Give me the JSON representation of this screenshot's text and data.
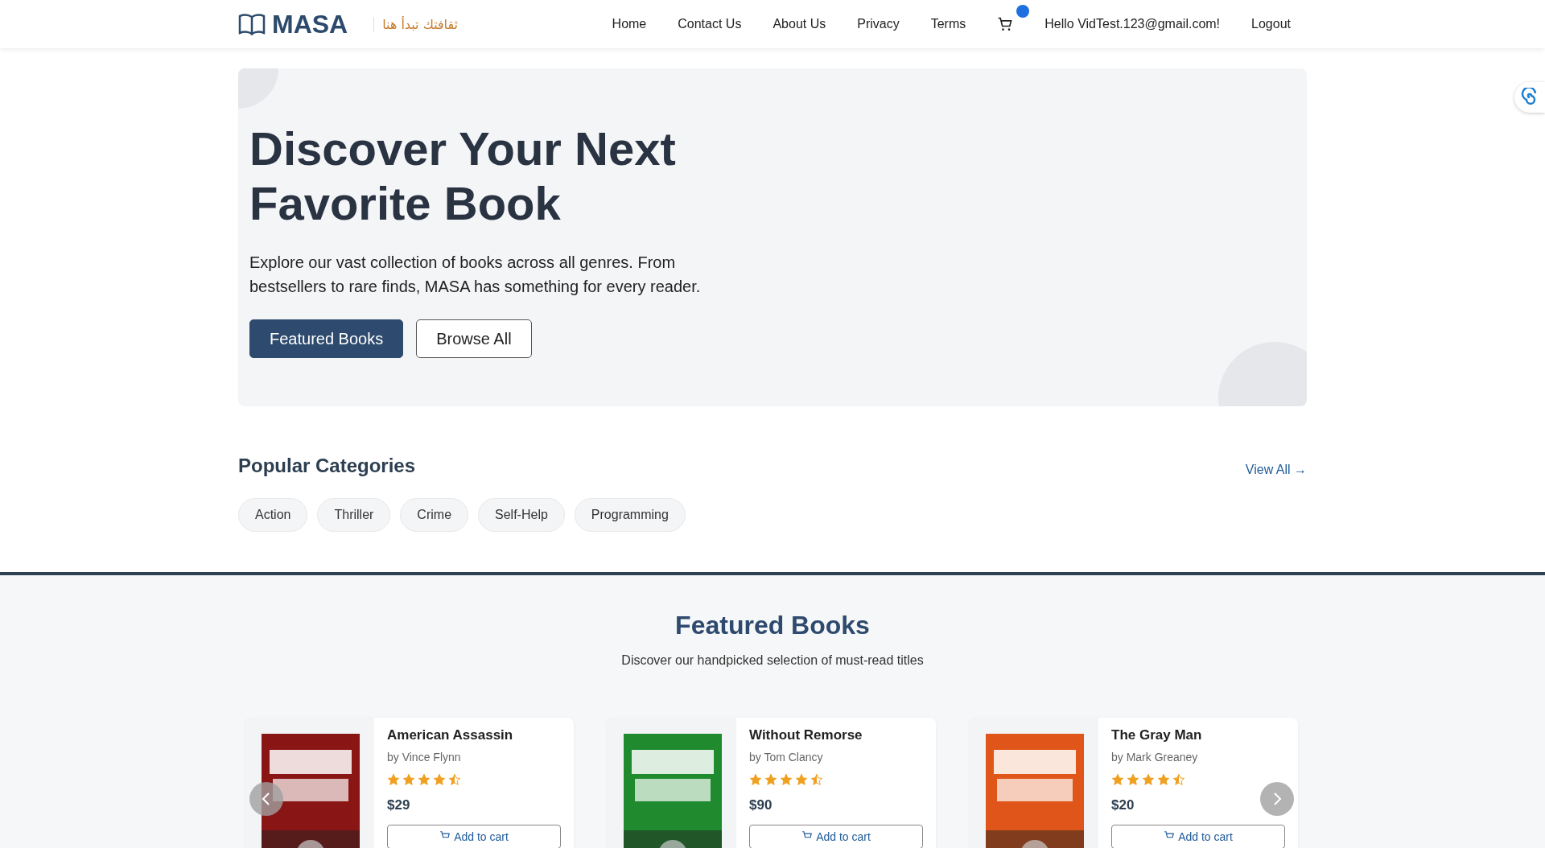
{
  "header": {
    "brand": "MASA",
    "tagline": "ثقافتك تبدأ هنا",
    "nav": [
      {
        "label": "Home",
        "kind": "link"
      },
      {
        "label": "Contact Us",
        "kind": "link"
      },
      {
        "label": "About Us",
        "kind": "link"
      },
      {
        "label": "Privacy",
        "kind": "link"
      },
      {
        "label": "Terms",
        "kind": "link"
      },
      {
        "kind": "cart"
      },
      {
        "label": "Hello VidTest.123@gmail.com!",
        "kind": "link"
      },
      {
        "label": "Logout",
        "kind": "link"
      }
    ]
  },
  "hero": {
    "title": "Discover Your Next Favorite Book",
    "text": "Explore our vast collection of books across all genres. From bestsellers to rare finds, MASA has something for every reader.",
    "buttons": [
      {
        "label": "Featured Books",
        "kind": "primary"
      },
      {
        "label": "Browse All",
        "kind": "outline"
      }
    ]
  },
  "categories": {
    "title": "Popular Categories",
    "view_all": "View All →",
    "items": [
      "Action",
      "Thriller",
      "Crime",
      "Self-Help",
      "Programming"
    ]
  },
  "featured": {
    "title": "Featured Books",
    "subtitle": "Discover our handpicked selection of must-read titles",
    "books": [
      {
        "title": "American Assassin",
        "author": "by Vince Flynn",
        "stars": 4.5,
        "price": "$29",
        "button": "Add to cart"
      },
      {
        "title": "Without Remorse",
        "author": "by Tom Clancy",
        "stars": 4.5,
        "price": "$90",
        "button": "Add to cart"
      },
      {
        "title": "The Gray Man",
        "author": "by Mark Greaney",
        "stars": 4.5,
        "price": "$20",
        "button": "Add to cart"
      }
    ]
  }
}
